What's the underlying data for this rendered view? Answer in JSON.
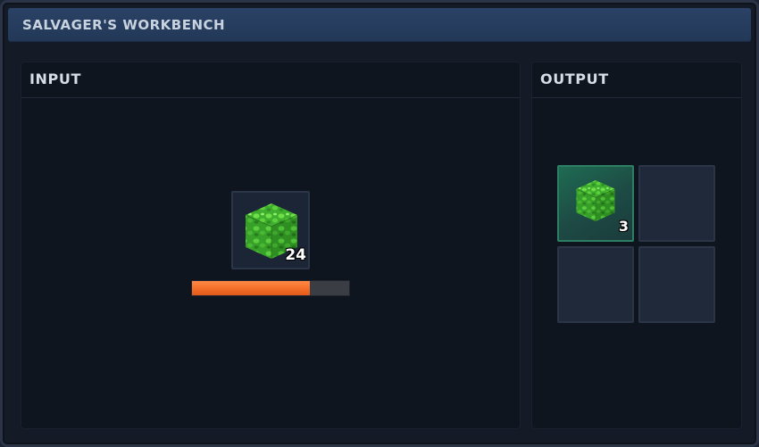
{
  "window": {
    "title": "SALVAGER'S WORKBENCH"
  },
  "input_panel": {
    "label": "INPUT",
    "slot": {
      "item": "moss-block-icon",
      "count": "24"
    },
    "progress": 0.75,
    "progress_color": "#f36b25"
  },
  "output_panel": {
    "label": "OUTPUT",
    "slots": [
      {
        "item": "moss-block-icon",
        "count": "3",
        "highlighted": true
      },
      {
        "item": null,
        "count": ""
      },
      {
        "item": null,
        "count": ""
      },
      {
        "item": null,
        "count": ""
      }
    ]
  },
  "colors": {
    "accent": "#2a4266",
    "highlight_slot": "#1f6b52",
    "moss": "#4cc23a"
  }
}
